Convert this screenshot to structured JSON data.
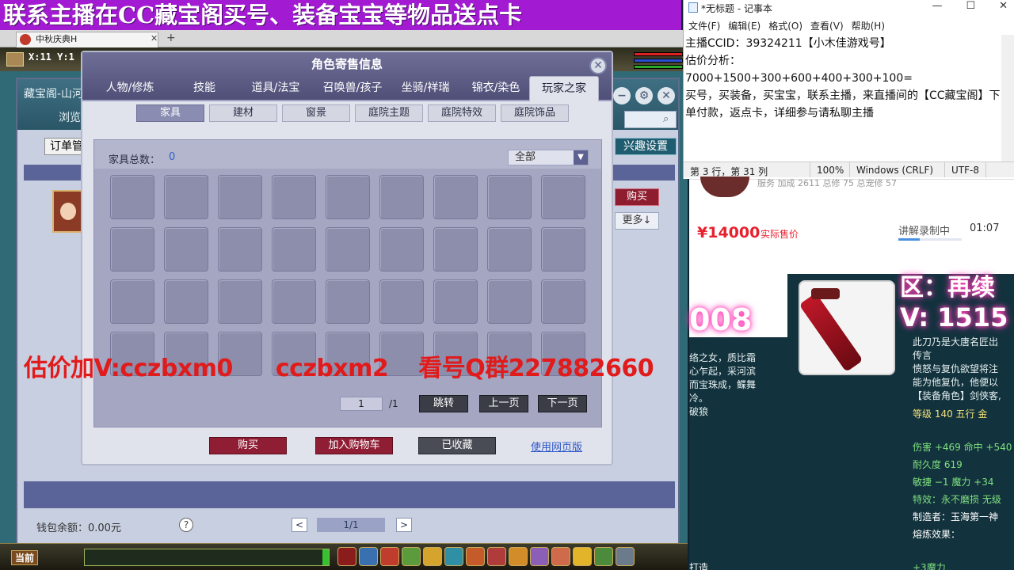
{
  "banner": {
    "text": "联系主播在CC藏宝阁买号、装备宝宝等物品送点卡"
  },
  "client": {
    "tab_title": "中秋庆典H",
    "tab_close": "✕",
    "tab_add": "+",
    "coords": "X:11 Y:1"
  },
  "store": {
    "title": "藏宝阁-山河",
    "nav": "浏览",
    "order_label": "订单管",
    "interest_label": "兴趣设置",
    "buy_label": "购买",
    "more_label": "更多↓",
    "wallet_label": "钱包余额：0.00元",
    "help": "?",
    "page_prev": "<",
    "page_next": ">",
    "page_num": "1/1",
    "ctrl_min": "−",
    "ctrl_settings": "⚙",
    "ctrl_close": "✕"
  },
  "dialog": {
    "title": "角色寄售信息",
    "close": "✕",
    "main_tabs": [
      "人物/修炼",
      "技能",
      "道具/法宝",
      "召唤兽/孩子",
      "坐骑/祥瑞",
      "锦衣/染色",
      "玩家之家"
    ],
    "active_main_tab": "玩家之家",
    "sub_tabs": [
      "家具",
      "建材",
      "窗景",
      "庭院主题",
      "庭院特效",
      "庭院饰品"
    ],
    "active_sub_tab": "家具",
    "count_label": "家具总数：",
    "count_value": "0",
    "filter_value": "全部",
    "filter_arrow": "▼",
    "pager": {
      "current": "1",
      "total": "/1",
      "jump": "跳转",
      "prev": "上一页",
      "next": "下一页"
    },
    "buttons": {
      "buy": "购买",
      "add_cart": "加入购物车",
      "favorited": "已收藏",
      "web_version": "使用网页版"
    }
  },
  "overlay": {
    "text1": "估价加V:cczbxm0",
    "text2": "cczbxm2",
    "text3": "看号Q群227882660"
  },
  "hotbar": {
    "current": "当前"
  },
  "notepad": {
    "title": "*无标题 - 记事本",
    "win_min": "—",
    "win_max": "☐",
    "win_close": "✕",
    "menu": [
      "文件(F)",
      "编辑(E)",
      "格式(O)",
      "查看(V)",
      "帮助(H)"
    ],
    "line1": "主播CCID：39324211【小木佳游戏号】",
    "line2": "估价分析：",
    "line3": "7000+1500+300+600+400+300+100=",
    "line4": "买号，买装备，买宝宝，联系主播，来直播间的【CC藏宝阁】下单付款，返点卡，详细参与请私聊主播",
    "status": {
      "pos": "第 3 行，第 31 列",
      "zoom": "100%",
      "eol": "Windows (CRLF)",
      "enc": "UTF-8"
    }
  },
  "shop": {
    "tiny": "服务 加成 2611 总修 75 总宠修 57",
    "price": "¥14000",
    "price_sub": "实际售价",
    "recording": "讲解录制中",
    "time": "01:07"
  },
  "lower": {
    "big_num": "008",
    "region": "区：再续",
    "vnum": "V: 1515",
    "lore_left": [
      "络之女，质比霜",
      "心乍起，采河滨",
      "而宝珠成，鲽舞",
      "冷。",
      "破狼"
    ],
    "lore_right": [
      "此刀乃是大唐名匠出",
      "传言",
      "愤怒与复仇欲望将注",
      "能为他复仇，他便以",
      "【装备角色】剑侠客,"
    ],
    "stats": [
      "等级 140  五行 金",
      "伤害 +469  命中 +540",
      "耐久度 619",
      "敏捷 −1  魔力 +34",
      "特效：永不磨损  无级",
      "制造者：玉海第一神",
      "熔炼效果：",
      "",
      "+3魔力"
    ],
    "footer": "打造"
  },
  "colors": {
    "banner": "#a21bd2",
    "dialog_header": "#5c5b86",
    "red_overlay": "#e11b1b",
    "price_red": "#e8212f",
    "neon_glow": "#ff3fb8"
  }
}
